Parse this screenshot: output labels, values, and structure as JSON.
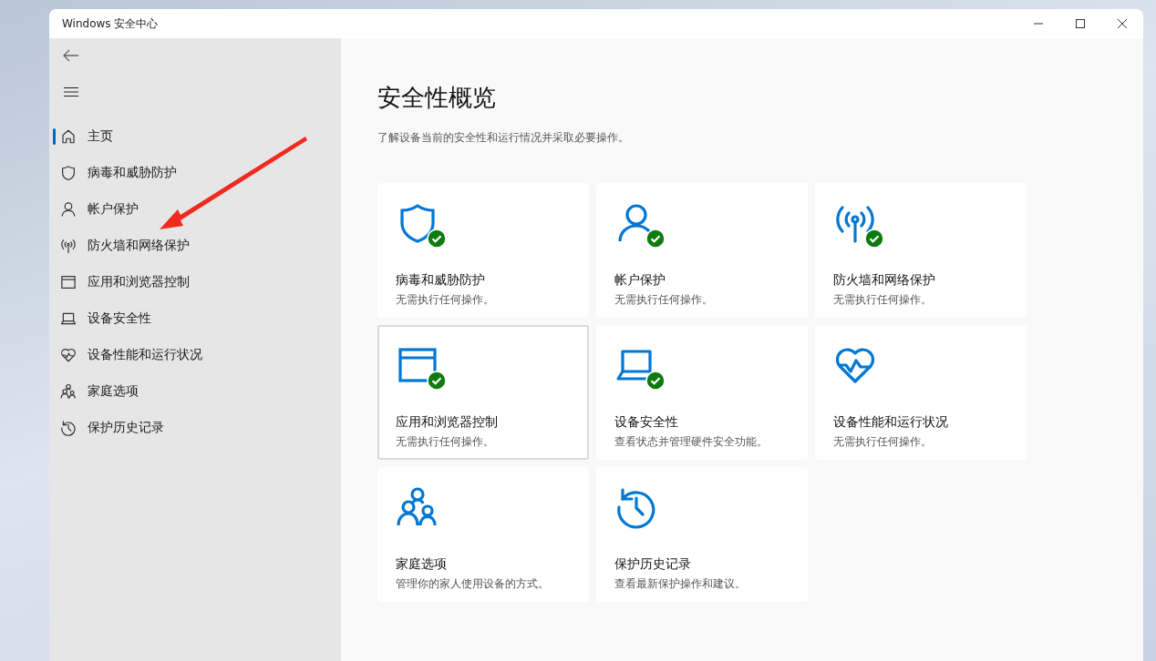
{
  "window": {
    "title": "Windows 安全中心"
  },
  "sidebar": {
    "items": [
      {
        "label": "主页",
        "kind": "home",
        "selected": true
      },
      {
        "label": "病毒和威胁防护",
        "kind": "shield",
        "selected": false
      },
      {
        "label": "帐户保护",
        "kind": "person",
        "selected": false
      },
      {
        "label": "防火墙和网络保护",
        "kind": "antenna",
        "selected": false
      },
      {
        "label": "应用和浏览器控制",
        "kind": "browser",
        "selected": false
      },
      {
        "label": "设备安全性",
        "kind": "laptop",
        "selected": false
      },
      {
        "label": "设备性能和运行状况",
        "kind": "heart",
        "selected": false
      },
      {
        "label": "家庭选项",
        "kind": "family",
        "selected": false
      },
      {
        "label": "保护历史记录",
        "kind": "history",
        "selected": false
      }
    ]
  },
  "page": {
    "title": "安全性概览",
    "subtitle": "了解设备当前的安全性和运行情况并采取必要操作。"
  },
  "cards": [
    {
      "kind": "shield",
      "title": "病毒和威胁防护",
      "description": "无需执行任何操作。",
      "ok": true,
      "focused": false
    },
    {
      "kind": "person",
      "title": "帐户保护",
      "description": "无需执行任何操作。",
      "ok": true,
      "focused": false
    },
    {
      "kind": "antenna",
      "title": "防火墙和网络保护",
      "description": "无需执行任何操作。",
      "ok": true,
      "focused": false
    },
    {
      "kind": "browser",
      "title": "应用和浏览器控制",
      "description": "无需执行任何操作。",
      "ok": true,
      "focused": true
    },
    {
      "kind": "laptop",
      "title": "设备安全性",
      "description": "查看状态并管理硬件安全功能。",
      "ok": true,
      "focused": false
    },
    {
      "kind": "heart",
      "title": "设备性能和运行状况",
      "description": "无需执行任何操作。",
      "ok": false,
      "focused": false
    },
    {
      "kind": "family",
      "title": "家庭选项",
      "description": "管理你的家人使用设备的方式。",
      "ok": false,
      "focused": false
    },
    {
      "kind": "history",
      "title": "保护历史记录",
      "description": "查看最新保护操作和建议。",
      "ok": false,
      "focused": false
    }
  ]
}
